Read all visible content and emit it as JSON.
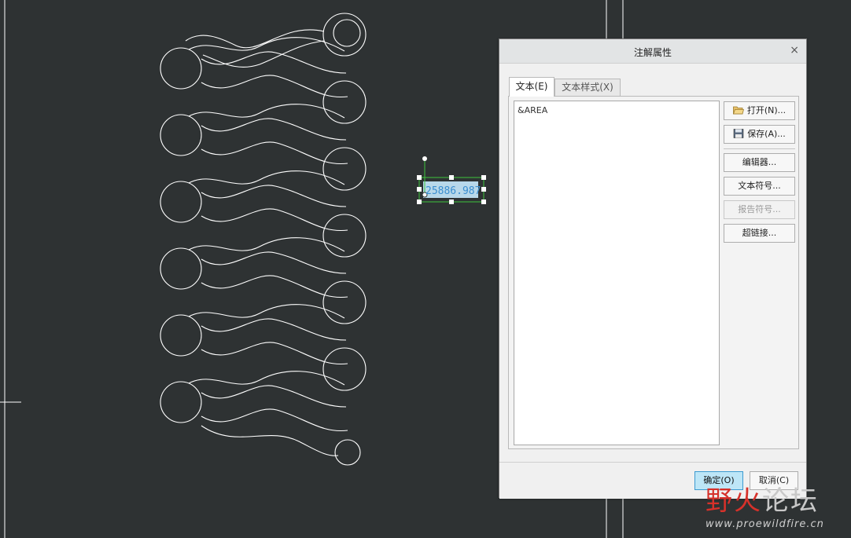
{
  "canvas": {
    "annotation_value": "25886.987"
  },
  "dialog": {
    "title": "注解属性",
    "close_label": "×",
    "tabs": [
      {
        "label": "文本(E)"
      },
      {
        "label": "文本样式(X)"
      }
    ],
    "text_value": "&AREA",
    "buttons": {
      "open": "打开(N)...",
      "save": "保存(A)...",
      "editor": "编辑器...",
      "text_symbol": "文本符号...",
      "report_symbol": "报告符号...",
      "hyperlink": "超链接..."
    },
    "ok": "确定(O)",
    "cancel": "取消(C)"
  },
  "watermark": {
    "cn_red": "野火",
    "cn_rest": "论坛",
    "url": "www.proewildfire.cn"
  },
  "colors": {
    "background": "#2e3233",
    "geometry": "#ffffff",
    "selection": "#3ec43e",
    "ok_button": "#bde6f7"
  }
}
